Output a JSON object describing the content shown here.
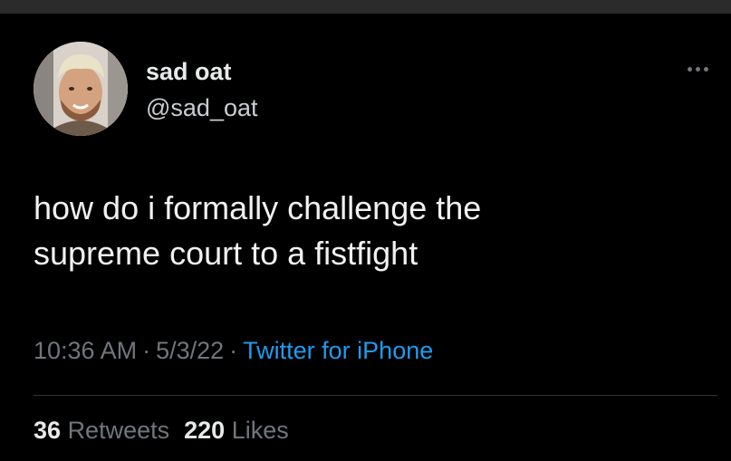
{
  "author": {
    "display_name": "sad oat",
    "handle": "@sad_oat"
  },
  "tweet": {
    "text_lines": [
      "how do i formally challenge the",
      "supreme court to a fistfight"
    ],
    "time": "10:36 AM",
    "date": "5/3/22",
    "source": "Twitter for iPhone"
  },
  "stats": {
    "retweets_count": "36",
    "retweets_label": "Retweets",
    "likes_count": "220",
    "likes_label": "Likes"
  },
  "icons": {
    "more": "more-horizontal-icon",
    "avatar": "profile-photo"
  },
  "colors": {
    "background": "#000000",
    "text": "#e7e9ea",
    "secondary_text": "#71767b",
    "link": "#1d9bf0"
  }
}
